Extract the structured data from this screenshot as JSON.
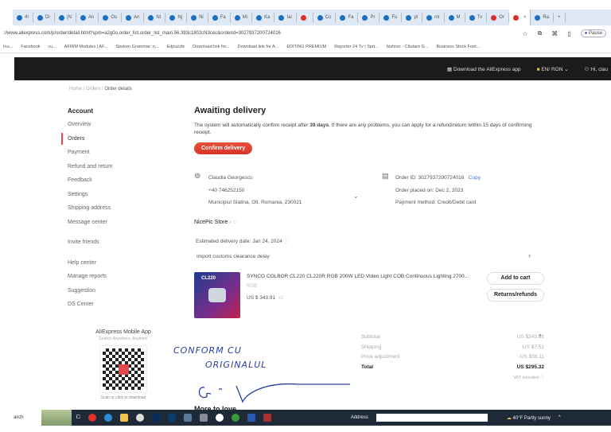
{
  "browser": {
    "tabs": [
      "4!",
      "Di",
      "(N",
      "An",
      "Os",
      "An",
      "NI",
      "Nj",
      "Ni",
      "Fa",
      "Mi",
      "Ka",
      "Iai",
      "",
      "Co",
      "Fa",
      "Pr",
      "Fu",
      "pl",
      "mi",
      "M",
      "Tv",
      "Or",
      "",
      "Ra"
    ],
    "new_tab": "+",
    "close_tab": "×",
    "url": "://www.aliexpress.com/p/order/detail.html?spm=a2g0o.order_list.order_list_main.56.393c1802cN3cec&orderid=3027937200724016",
    "profile": "Pause",
    "bookmarks": [
      "Inu...",
      "Facebook",
      "cu...",
      "AFIRM Modules | AF...",
      "Spoken Grammar: n...",
      "Edpuzzle",
      "Download link for...",
      "Download link for A...",
      "EDITING PREMIUM",
      "Reporter 24 Tv | Sprt...",
      "fashion - Căutare G...",
      "Business Stock Foot..."
    ]
  },
  "header": {
    "download_app": "Download the AliExpress app",
    "locale": "EN/ RON",
    "greeting": "Hi, clau"
  },
  "breadcrumb": [
    "Home",
    "Orders",
    "Order details"
  ],
  "sidebar": {
    "title": "Account",
    "items": [
      "Overview",
      "Orders",
      "Payment",
      "Refund and return",
      "Feedback",
      "Settings",
      "Shipping address",
      "Message center"
    ],
    "items2": [
      "Invite friends"
    ],
    "items3": [
      "Help center",
      "Manage reports",
      "Suggestion",
      "DS Center"
    ]
  },
  "order": {
    "status": "Awaiting delivery",
    "desc_before": "The system will automatically confirm receipt after ",
    "desc_bold": "39 days",
    "desc_after": ". If there are any problems, you can apply for a refund/return within 15 days of confirming receipt.",
    "confirm_button": "Confirm delivery",
    "name": "Claudia Georgescu",
    "phone": "+40 746252150",
    "address": "Municipiul Slatina, Olt, Romania, 230021",
    "order_id": "Order ID: 3027937200724016",
    "copy": "Copy",
    "placed": "Order placed on: Dec 2, 2023",
    "payment": "Payment method: Credit/Debit card",
    "store": "NicePic Store",
    "est_delivery": "Estimated delivery date: Jan 24, 2024",
    "customs": "Import customs clearance delay",
    "product_title": "SYNCO COLBOR CL220 CL220R RGB 200W LED Video Light COB Continuous Lighting 2700...",
    "variant": "RGB",
    "price": "US $ 343.91",
    "qty": "x1",
    "image_label": "CL220",
    "add_to_cart": "Add to cart",
    "returns": "Returns/refunds"
  },
  "summary": {
    "rows": [
      {
        "label": "Subtotal",
        "value": "US $343.91"
      },
      {
        "label": "Shipping",
        "value": "US $7.52"
      },
      {
        "label": "Price adjustment",
        "value": "-US $56.11"
      }
    ],
    "total_label": "Total",
    "total_value": "US $295.32",
    "vat": "VAT included"
  },
  "app": {
    "title": "AliExpress Mobile App",
    "subtitle": "Search Anywhere, Anytime!",
    "scan": "Scan or click to download"
  },
  "more": "More to love",
  "handwriting": {
    "line1": "CONFORM CU",
    "line2": "ORIGINALUL"
  },
  "taskbar": {
    "search": "arch",
    "address_label": "Address",
    "weather": "40°F  Partly sunny"
  },
  "colors": {
    "accent": "#e5484d",
    "header": "#1b1b1b"
  }
}
